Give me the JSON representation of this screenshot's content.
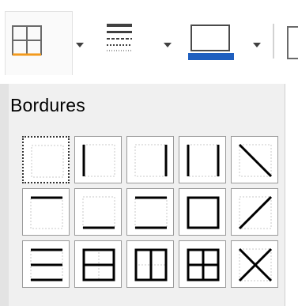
{
  "toolbar": {
    "borders_button": {
      "icon": "table-borders-icon",
      "accent": "#f39a1c"
    },
    "line_style_button": {
      "icon": "line-style-icon"
    },
    "border_color_button": {
      "icon": "border-color-icon",
      "accent": "#1f5fbf"
    },
    "dropdown_icon": "chevron-down-icon"
  },
  "panel": {
    "title": "Bordures",
    "presets": [
      {
        "name": "no-borders"
      },
      {
        "name": "left-border"
      },
      {
        "name": "right-border"
      },
      {
        "name": "left-right-borders"
      },
      {
        "name": "diagonal-down"
      },
      {
        "name": "top-border"
      },
      {
        "name": "bottom-border"
      },
      {
        "name": "top-bottom-borders"
      },
      {
        "name": "outer-border"
      },
      {
        "name": "diagonal-up"
      },
      {
        "name": "top-bottom-inner-horizontal"
      },
      {
        "name": "outer-inner-horizontal"
      },
      {
        "name": "outer-inner-vertical"
      },
      {
        "name": "all-borders"
      },
      {
        "name": "diagonal-cross"
      }
    ]
  }
}
